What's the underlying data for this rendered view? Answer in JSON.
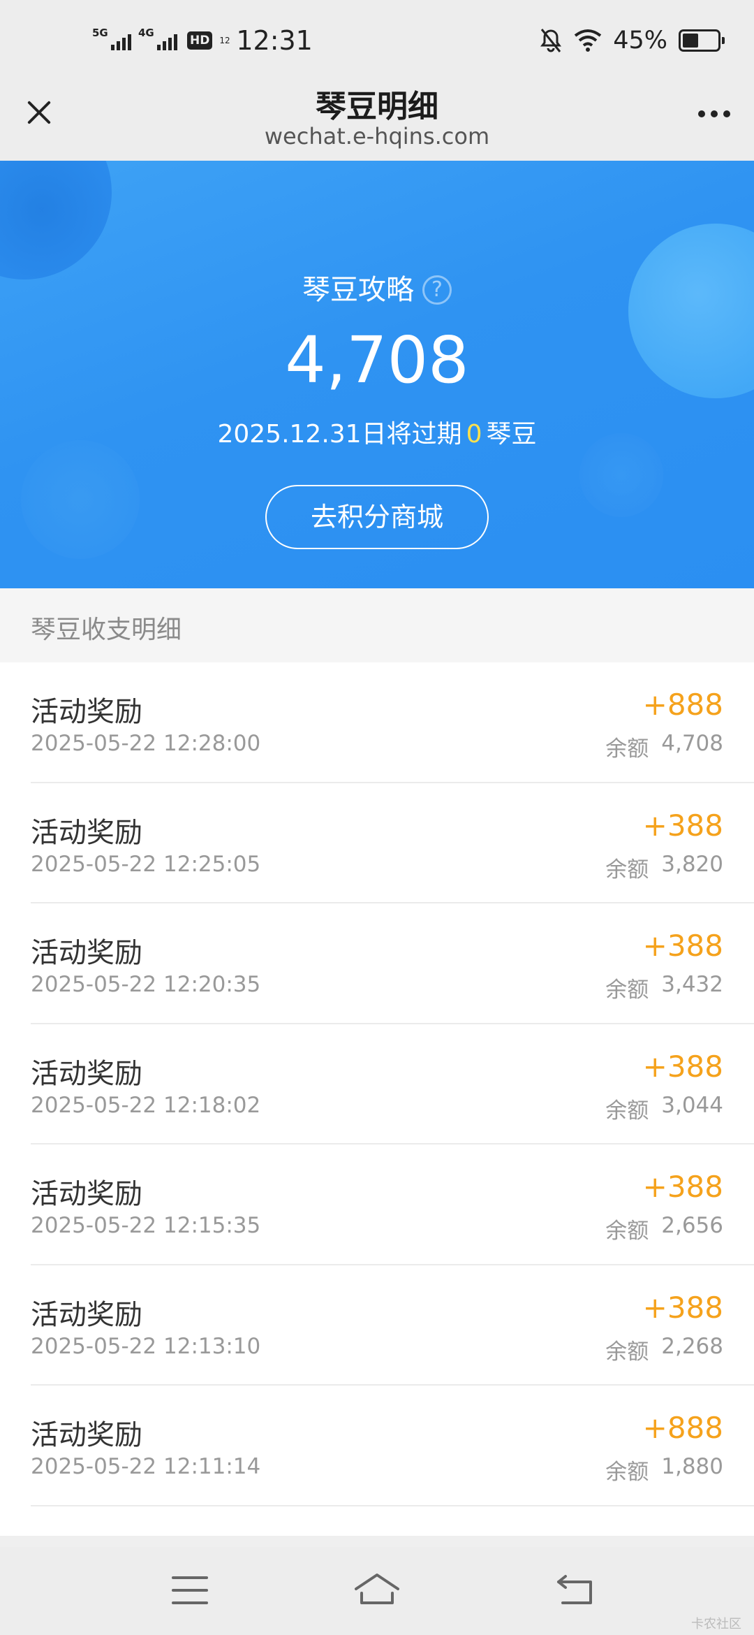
{
  "status_bar": {
    "signal1_label": "5G",
    "signal2_label": "4G",
    "hd_label": "HD",
    "hd_sub": "12",
    "time": "12:31",
    "battery_percent": "45%",
    "battery_level": 0.45
  },
  "nav": {
    "title": "琴豆明细",
    "url": "wechat.e-hqins.com",
    "icons": [
      "close-icon",
      "more-icon"
    ]
  },
  "hero": {
    "title": "琴豆攻略",
    "help_icon": "?",
    "amount": "4,708",
    "expire_prefix": "2025.12.31日将过期",
    "expire_count": "0",
    "expire_suffix": "琴豆",
    "button_label": "去积分商城",
    "colors": {
      "accent": "#2b8ff2",
      "highlight": "#ffe14d"
    }
  },
  "section": {
    "title": "琴豆收支明细"
  },
  "list": {
    "balance_label": "余额",
    "amount_color": "#f5a21c",
    "rows": [
      {
        "title": "活动奖励",
        "time": "2025-05-22 12:28:00",
        "amount": "+888",
        "balance": "4,708"
      },
      {
        "title": "活动奖励",
        "time": "2025-05-22 12:25:05",
        "amount": "+388",
        "balance": "3,820"
      },
      {
        "title": "活动奖励",
        "time": "2025-05-22 12:20:35",
        "amount": "+388",
        "balance": "3,432"
      },
      {
        "title": "活动奖励",
        "time": "2025-05-22 12:18:02",
        "amount": "+388",
        "balance": "3,044"
      },
      {
        "title": "活动奖励",
        "time": "2025-05-22 12:15:35",
        "amount": "+388",
        "balance": "2,656"
      },
      {
        "title": "活动奖励",
        "time": "2025-05-22 12:13:10",
        "amount": "+388",
        "balance": "2,268"
      },
      {
        "title": "活动奖励",
        "time": "2025-05-22 12:11:14",
        "amount": "+888",
        "balance": "1,880"
      }
    ]
  },
  "system_nav": {
    "icons": [
      "menu-icon",
      "home-icon",
      "back-icon"
    ]
  },
  "watermark": "卡农社区"
}
